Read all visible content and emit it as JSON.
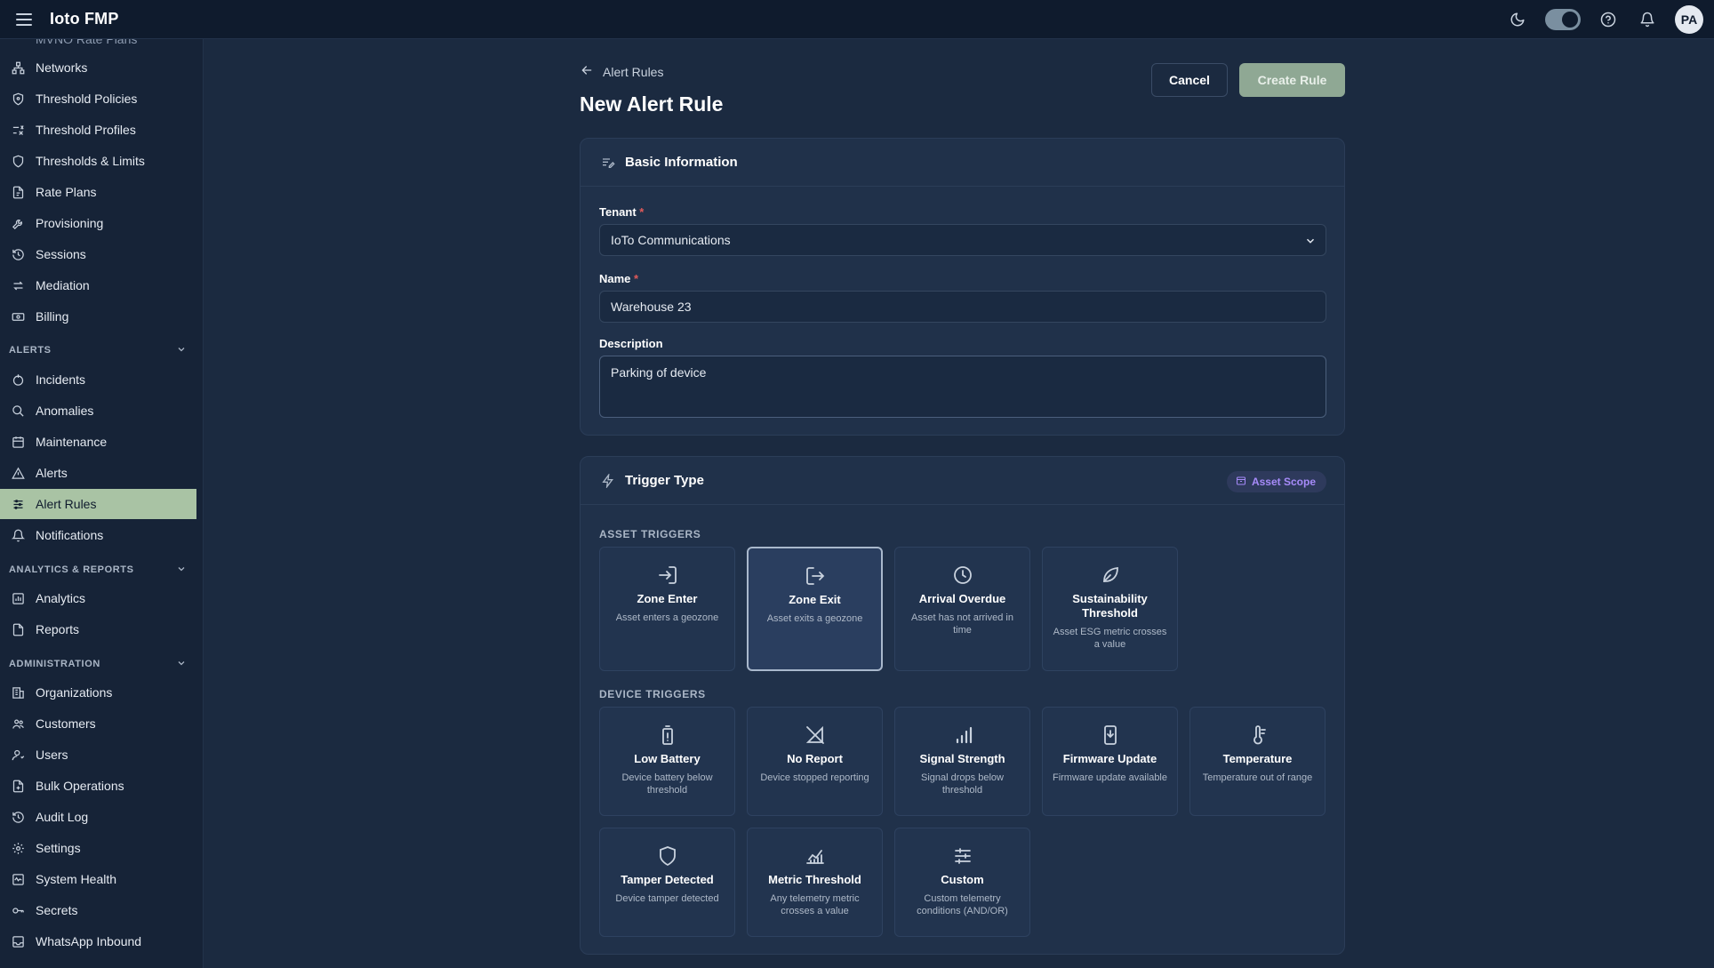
{
  "app": {
    "title": "Ioto FMP"
  },
  "topbar": {
    "avatar_initials": "PA"
  },
  "sidebar": {
    "partial_item": "MVNO Rate Plans",
    "items_top": [
      {
        "label": "Networks",
        "icon": "network-icon"
      },
      {
        "label": "Threshold Policies",
        "icon": "shield-policy-icon"
      },
      {
        "label": "Threshold Profiles",
        "icon": "sliders-icon"
      },
      {
        "label": "Thresholds & Limits",
        "icon": "shield-icon"
      },
      {
        "label": "Rate Plans",
        "icon": "document-icon"
      },
      {
        "label": "Provisioning",
        "icon": "wrench-icon"
      },
      {
        "label": "Sessions",
        "icon": "history-icon"
      },
      {
        "label": "Mediation",
        "icon": "arrows-swap-icon"
      },
      {
        "label": "Billing",
        "icon": "cash-icon"
      }
    ],
    "sections": {
      "alerts": "ALERTS",
      "analytics": "ANALYTICS & REPORTS",
      "administration": "ADMINISTRATION"
    },
    "alerts_items": [
      {
        "label": "Incidents"
      },
      {
        "label": "Anomalies"
      },
      {
        "label": "Maintenance"
      },
      {
        "label": "Alerts"
      },
      {
        "label": "Alert Rules"
      },
      {
        "label": "Notifications"
      }
    ],
    "analytics_items": [
      {
        "label": "Analytics"
      },
      {
        "label": "Reports"
      }
    ],
    "admin_items": [
      {
        "label": "Organizations"
      },
      {
        "label": "Customers"
      },
      {
        "label": "Users"
      },
      {
        "label": "Bulk Operations"
      },
      {
        "label": "Audit Log"
      },
      {
        "label": "Settings"
      },
      {
        "label": "System Health"
      },
      {
        "label": "Secrets"
      },
      {
        "label": "WhatsApp Inbound"
      }
    ]
  },
  "header": {
    "back_label": "Alert Rules",
    "title": "New Alert Rule",
    "cancel_label": "Cancel",
    "create_label": "Create Rule"
  },
  "basic_info": {
    "heading": "Basic Information",
    "tenant_label": "Tenant",
    "tenant_value": "IoTo Communications",
    "name_label": "Name",
    "name_value": "Warehouse 23",
    "description_label": "Description",
    "description_value": "Parking of device",
    "required_mark": "*"
  },
  "trigger": {
    "heading": "Trigger Type",
    "scope_badge": "Asset Scope",
    "asset_group": "ASSET TRIGGERS",
    "device_group": "DEVICE TRIGGERS",
    "asset_tiles": [
      {
        "title": "Zone Enter",
        "desc": "Asset enters a geozone"
      },
      {
        "title": "Zone Exit",
        "desc": "Asset exits a geozone"
      },
      {
        "title": "Arrival Overdue",
        "desc": "Asset has not arrived in time"
      },
      {
        "title": "Sustainability Threshold",
        "desc": "Asset ESG metric crosses a value"
      }
    ],
    "device_tiles": [
      {
        "title": "Low Battery",
        "desc": "Device battery below threshold"
      },
      {
        "title": "No Report",
        "desc": "Device stopped reporting"
      },
      {
        "title": "Signal Strength",
        "desc": "Signal drops below threshold"
      },
      {
        "title": "Firmware Update",
        "desc": "Firmware update available"
      },
      {
        "title": "Temperature",
        "desc": "Temperature out of range"
      },
      {
        "title": "Tamper Detected",
        "desc": "Device tamper detected"
      },
      {
        "title": "Metric Threshold",
        "desc": "Any telemetry metric crosses a value"
      },
      {
        "title": "Custom",
        "desc": "Custom telemetry conditions (AND/OR)"
      }
    ],
    "selected": "Zone Exit"
  }
}
